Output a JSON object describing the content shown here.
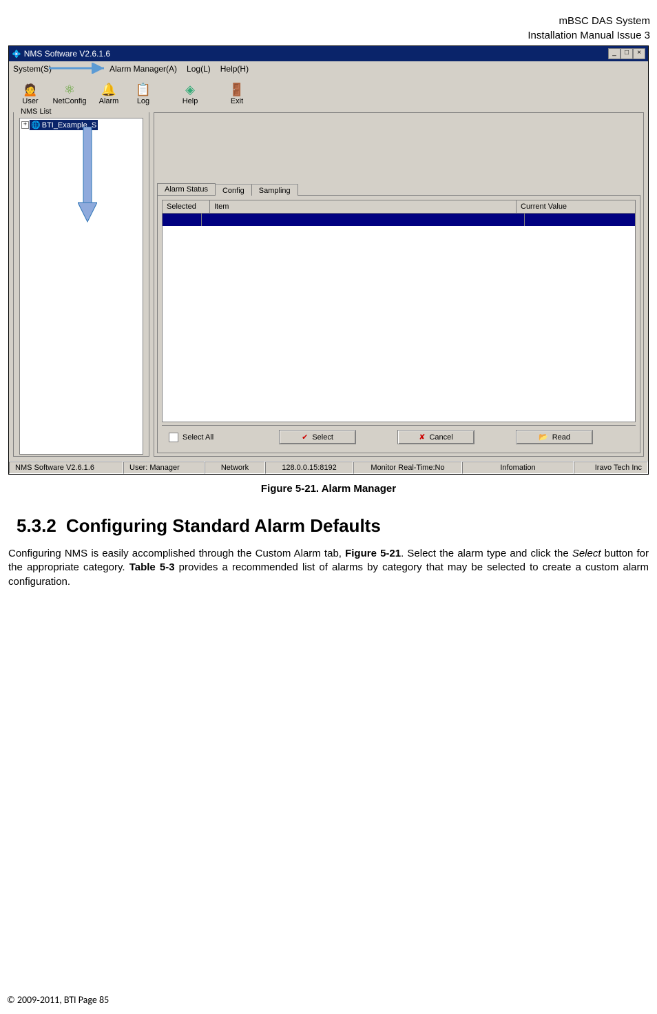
{
  "doc_header": {
    "line1": "mBSC DAS System",
    "line2": "Installation Manual Issue 3"
  },
  "app": {
    "title": "NMS Software V2.6.1.6",
    "menubar": [
      "System(S)",
      "Alarm Manager(A)",
      "Log(L)",
      "Help(H)"
    ],
    "toolbar": [
      {
        "icon": "👤",
        "label": "User"
      },
      {
        "icon": "🕸",
        "label": "NetConfig"
      },
      {
        "icon": "🔔",
        "label": "Alarm"
      },
      {
        "icon": "📄",
        "label": "Log"
      },
      {
        "icon": "◇",
        "label": "Help"
      },
      {
        "icon": "🚪",
        "label": "Exit"
      }
    ],
    "nms_panel_title": "NMS List",
    "tree_item": "BTI_Example_S",
    "tabs": [
      "Alarm Status",
      "Config",
      "Sampling"
    ],
    "grid_headers": [
      "Selected",
      "Item",
      "Current Value"
    ],
    "select_all": "Select All",
    "buttons": {
      "select": "Select",
      "cancel": "Cancel",
      "read": "Read"
    },
    "statusbar": {
      "app": "NMS Software V2.6.1.6",
      "user": "User: Manager",
      "network": "Network",
      "ip": "128.0.0.15:8192",
      "monitor": "Monitor Real-Time:No",
      "info": "Infomation",
      "company": "Iravo Tech Inc"
    }
  },
  "caption": "Figure 5-21. Alarm Manager",
  "section": {
    "number": "5.3.2",
    "title": "Configuring Standard Alarm Defaults"
  },
  "body": {
    "p1a": "Configuring NMS is easily accomplished through the Custom Alarm tab, ",
    "p1b": "Figure 5-21",
    "p1c": ". Select the alarm type and click the ",
    "p1d": "Select",
    "p1e": " button for the appropriate category. ",
    "p1f": "Table 5-3",
    "p1g": " provides a recommended list of alarms by category that may be selected to create a custom alarm configuration."
  },
  "footer": "© 2009‐2011, BTI Page 85"
}
